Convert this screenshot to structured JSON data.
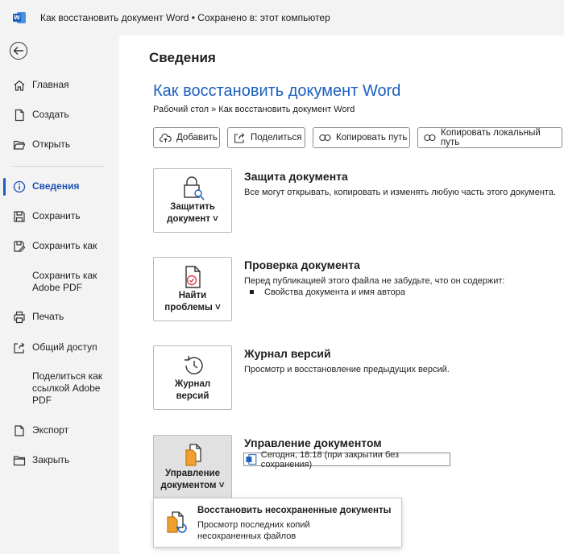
{
  "titlebar": {
    "title": "Как восстановить документ Word  •  Сохранено в: этот компьютер"
  },
  "sidebar": {
    "items": [
      {
        "label": "Главная",
        "icon": "home-icon"
      },
      {
        "label": "Создать",
        "icon": "new-document-icon"
      },
      {
        "label": "Открыть",
        "icon": "open-folder-icon"
      },
      {
        "label": "Сведения",
        "icon": "info-icon",
        "active": true
      },
      {
        "label": "Сохранить",
        "icon": "save-icon"
      },
      {
        "label": "Сохранить как",
        "icon": "save-as-icon"
      },
      {
        "label": "Сохранить как Adobe PDF",
        "icon": ""
      },
      {
        "label": "Печать",
        "icon": "print-icon"
      },
      {
        "label": "Общий доступ",
        "icon": "share-icon"
      },
      {
        "label": "Поделиться как ссылкой Adobe PDF",
        "icon": ""
      },
      {
        "label": "Экспорт",
        "icon": "export-icon"
      },
      {
        "label": "Закрыть",
        "icon": "close-folder-icon"
      }
    ]
  },
  "main": {
    "page_title": "Сведения",
    "doc_title": "Как восстановить документ Word",
    "breadcrumb": "Рабочий стол » Как восстановить документ Word",
    "buttons": {
      "add": "Добавить",
      "share": "Поделиться",
      "copy_path": "Копировать путь",
      "copy_local_path": "Копировать локальный путь"
    },
    "protect": {
      "card_line1": "Защитить",
      "card_line2": "документ ˅",
      "heading": "Защита документа",
      "text": "Все могут открывать, копировать и изменять любую часть этого документа."
    },
    "inspect": {
      "card_line1": "Найти",
      "card_line2": "проблемы ˅",
      "heading": "Проверка документа",
      "text": "Перед публикацией этого файла не забудьте, что он содержит:",
      "bullet": "Свойства документа и имя автора"
    },
    "history": {
      "card_line1": "Журнал",
      "card_line2": "версий",
      "heading": "Журнал версий",
      "text": "Просмотр и восстановление предыдущих версий."
    },
    "manage": {
      "card_line1": "Управление",
      "card_line2": "документом ˅",
      "heading": "Управление документом",
      "version_entry": "Сегодня, 18:18 (при закрытии без сохранения)"
    },
    "popup": {
      "heading": "Восстановить несохраненные документы",
      "text": "Просмотр последних копий несохраненных файлов"
    }
  },
  "colors": {
    "accent": "#1c5fbf",
    "sidebar_bg": "#f3f3f3",
    "orange": "#f0a030"
  }
}
